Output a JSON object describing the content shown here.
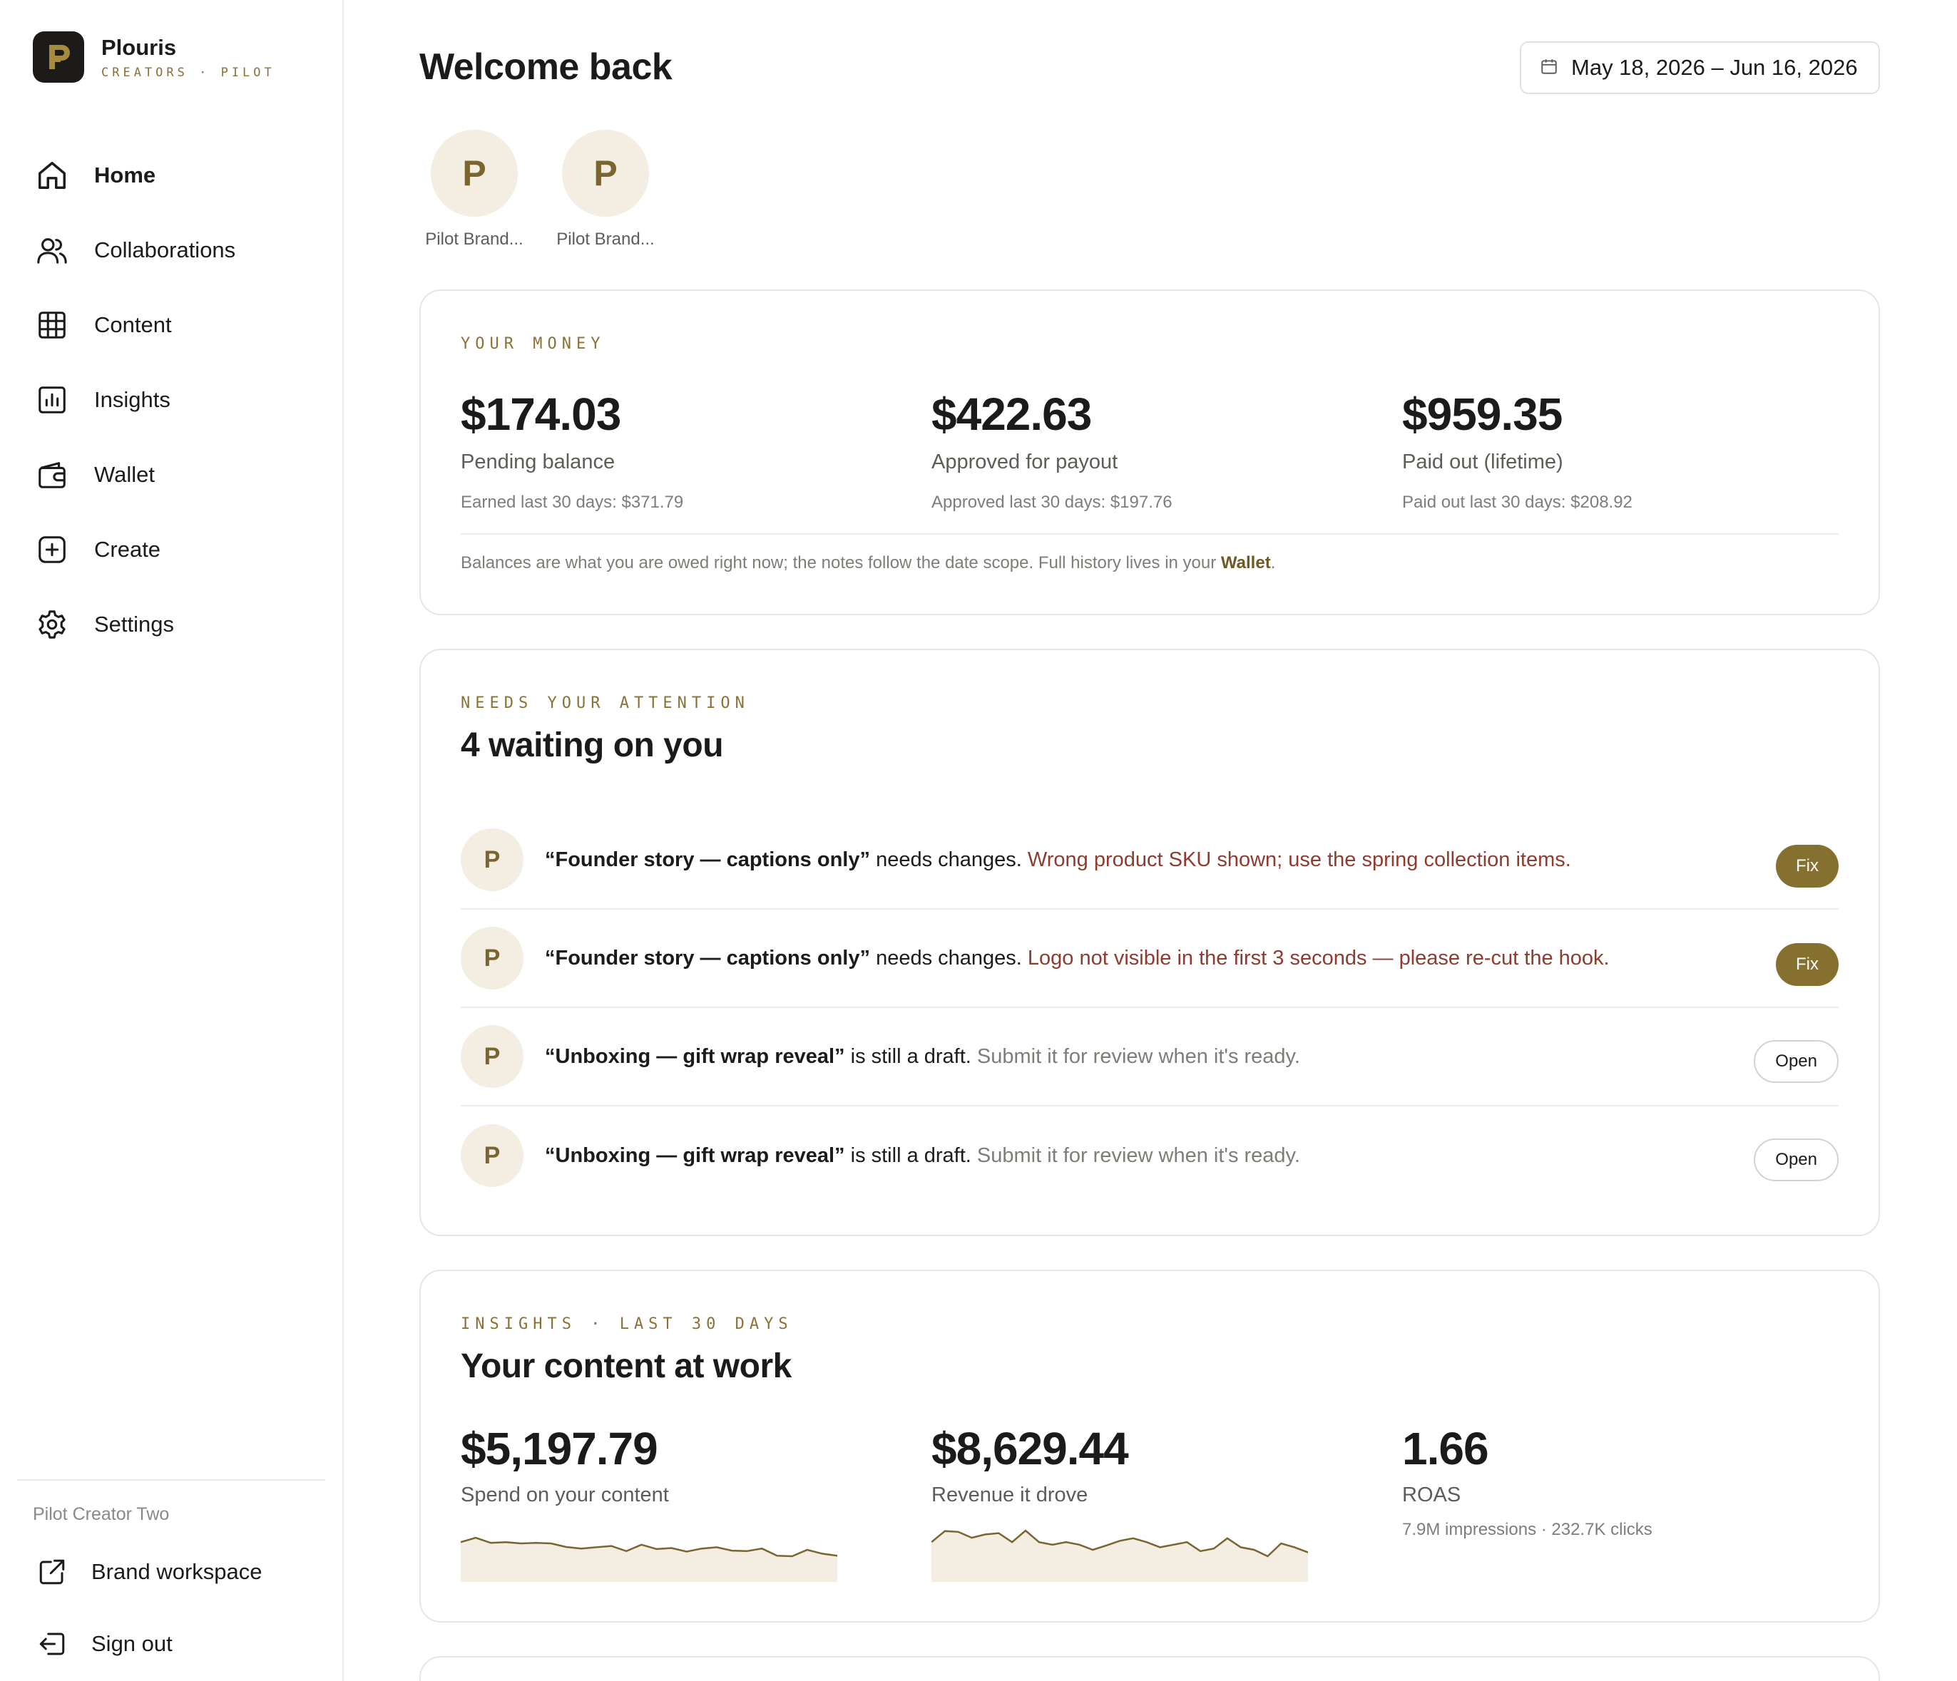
{
  "sidebar": {
    "brand_name": "Plouris",
    "brand_sub": "CREATORS · PILOT",
    "nav": [
      {
        "label": "Home",
        "icon": "home-icon"
      },
      {
        "label": "Collaborations",
        "icon": "users-icon"
      },
      {
        "label": "Content",
        "icon": "grid-icon"
      },
      {
        "label": "Insights",
        "icon": "chart-icon"
      },
      {
        "label": "Wallet",
        "icon": "wallet-icon"
      },
      {
        "label": "Create",
        "icon": "plus-square-icon"
      },
      {
        "label": "Settings",
        "icon": "gear-icon"
      }
    ],
    "active": "Home",
    "user_name": "Pilot Creator Two",
    "brand_workspace": "Brand workspace",
    "sign_out": "Sign out"
  },
  "header": {
    "title": "Welcome back",
    "date_range": "May 18, 2026 – Jun 16, 2026"
  },
  "brands": [
    {
      "initial": "P",
      "label": "Pilot Brand..."
    },
    {
      "initial": "P",
      "label": "Pilot Brand..."
    }
  ],
  "money": {
    "eyebrow": "YOUR MONEY",
    "metrics": [
      {
        "value": "$174.03",
        "label": "Pending balance",
        "note": "Earned last 30 days: $371.79"
      },
      {
        "value": "$422.63",
        "label": "Approved for payout",
        "note": "Approved last 30 days: $197.76"
      },
      {
        "value": "$959.35",
        "label": "Paid out (lifetime)",
        "note": "Paid out last 30 days: $208.92"
      }
    ],
    "footer_text": "Balances are what you are owed right now; the notes follow the date scope. Full history lives in your",
    "footer_link": "Wallet",
    "footer_end": "."
  },
  "attention": {
    "eyebrow": "NEEDS YOUR ATTENTION",
    "title": "4 waiting on you",
    "tasks": [
      {
        "initial": "P",
        "title": "“Founder story — captions only”",
        "status": "needs changes.",
        "note": "Wrong product SKU shown; use the spring collection items.",
        "action": "Fix"
      },
      {
        "initial": "P",
        "title": "“Founder story — captions only”",
        "status": "needs changes.",
        "note": "Logo not visible in the first 3 seconds — please re-cut the hook.",
        "action": "Fix"
      },
      {
        "initial": "P",
        "title": "“Unboxing — gift wrap reveal”",
        "status": "is still a draft.",
        "note": "Submit it for review when it's ready.",
        "action": "Open"
      },
      {
        "initial": "P",
        "title": "“Unboxing — gift wrap reveal”",
        "status": "is still a draft.",
        "note": "Submit it for review when it's ready.",
        "action": "Open"
      }
    ]
  },
  "insights": {
    "eyebrow": "INSIGHTS · LAST 30 DAYS",
    "title": "Your content at work",
    "kpis": [
      {
        "value": "$5,197.79",
        "label": "Spend on your content"
      },
      {
        "value": "$8,629.44",
        "label": "Revenue it drove"
      },
      {
        "value": "1.66",
        "label": "ROAS",
        "note": "7.9M impressions · 232.7K clicks"
      }
    ],
    "spend_trend": [
      0.55,
      0.72,
      0.52,
      0.55,
      0.5,
      0.52,
      0.5,
      0.36,
      0.3,
      0.35,
      0.4,
      0.2,
      0.45,
      0.28,
      0.32,
      0.18,
      0.3,
      0.35,
      0.22,
      0.2,
      0.3,
      0.02,
      0.0,
      0.25,
      0.1,
      0.02
    ],
    "revenue_trend": [
      0.55,
      0.98,
      0.95,
      0.72,
      0.85,
      0.9,
      0.55,
      1.0,
      0.55,
      0.45,
      0.55,
      0.45,
      0.25,
      0.42,
      0.6,
      0.7,
      0.55,
      0.35,
      0.45,
      0.55,
      0.2,
      0.3,
      0.7,
      0.35,
      0.25,
      0.0,
      0.5,
      0.35,
      0.15
    ],
    "trend_color": "#7a6430",
    "trend_fill": "#f3ede2"
  },
  "colors": {
    "accent": "#85702f",
    "alert": "#8e3b30",
    "avatar_bg": "#f3ede2"
  }
}
